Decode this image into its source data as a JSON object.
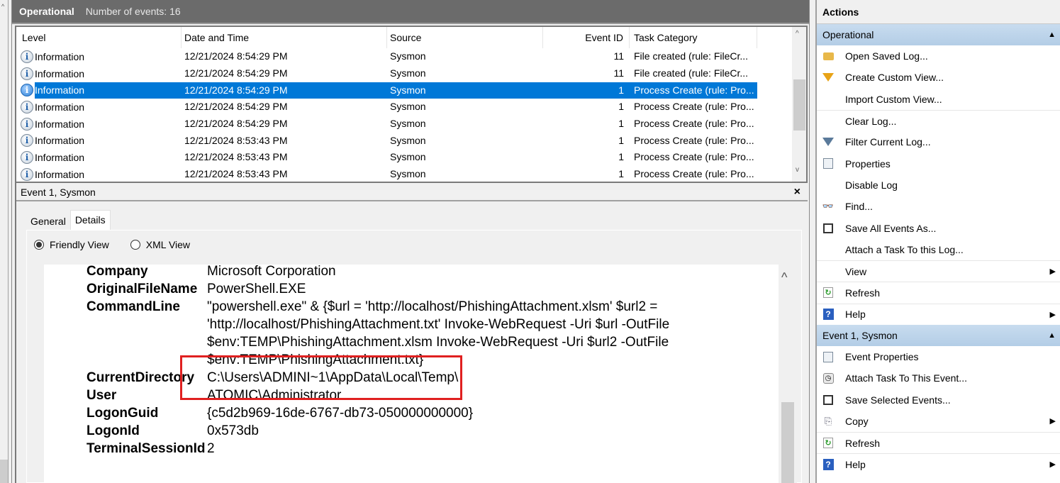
{
  "log": {
    "name": "Operational",
    "event_count": "Number of events: 16"
  },
  "events_table": {
    "columns": [
      "Level",
      "Date and Time",
      "Source",
      "Event ID",
      "Task Category"
    ],
    "rows": [
      {
        "level": "Information",
        "datetime": "12/21/2024 8:54:29 PM",
        "source": "Sysmon",
        "event_id": "11",
        "task": "File created (rule: FileCr...",
        "selected": false
      },
      {
        "level": "Information",
        "datetime": "12/21/2024 8:54:29 PM",
        "source": "Sysmon",
        "event_id": "11",
        "task": "File created (rule: FileCr...",
        "selected": false
      },
      {
        "level": "Information",
        "datetime": "12/21/2024 8:54:29 PM",
        "source": "Sysmon",
        "event_id": "1",
        "task": "Process Create (rule: Pro...",
        "selected": true
      },
      {
        "level": "Information",
        "datetime": "12/21/2024 8:54:29 PM",
        "source": "Sysmon",
        "event_id": "1",
        "task": "Process Create (rule: Pro...",
        "selected": false
      },
      {
        "level": "Information",
        "datetime": "12/21/2024 8:54:29 PM",
        "source": "Sysmon",
        "event_id": "1",
        "task": "Process Create (rule: Pro...",
        "selected": false
      },
      {
        "level": "Information",
        "datetime": "12/21/2024 8:53:43 PM",
        "source": "Sysmon",
        "event_id": "1",
        "task": "Process Create (rule: Pro...",
        "selected": false
      },
      {
        "level": "Information",
        "datetime": "12/21/2024 8:53:43 PM",
        "source": "Sysmon",
        "event_id": "1",
        "task": "Process Create (rule: Pro...",
        "selected": false
      },
      {
        "level": "Information",
        "datetime": "12/21/2024 8:53:43 PM",
        "source": "Sysmon",
        "event_id": "1",
        "task": "Process Create (rule: Pro...",
        "selected": false
      }
    ]
  },
  "detail": {
    "title": "Event 1, Sysmon",
    "close_icon": "×",
    "tabs": [
      {
        "label": "General",
        "active": false
      },
      {
        "label": "Details",
        "active": true
      }
    ],
    "view_options": [
      {
        "label": "Friendly View",
        "checked": true
      },
      {
        "label": "XML View",
        "checked": false
      }
    ],
    "fields": [
      {
        "key": "Company",
        "value": "Microsoft Corporation"
      },
      {
        "key": "OriginalFileName",
        "value": "PowerShell.EXE"
      },
      {
        "key": "CommandLine",
        "value": "\"powershell.exe\" & {$url = 'http://localhost/PhishingAttachment.xlsm' $url2 = 'http://localhost/PhishingAttachment.txt' Invoke-WebRequest -Uri $url -OutFile $env:TEMP\\PhishingAttachment.xlsm Invoke-WebRequest -Uri $url2 -OutFile $env:TEMP\\PhishingAttachment.txt}"
      },
      {
        "key": "CurrentDirectory",
        "value": "C:\\Users\\ADMINI~1\\AppData\\Local\\Temp\\"
      },
      {
        "key": "User",
        "value": "ATOMIC\\Administrator"
      },
      {
        "key": "LogonGuid",
        "value": "{c5d2b969-16de-6767-db73-050000000000}"
      },
      {
        "key": "LogonId",
        "value": "0x573db"
      },
      {
        "key": "TerminalSessionId",
        "value": "2"
      }
    ],
    "highlight_color": "#e02020"
  },
  "actions": {
    "title": "Actions",
    "groups": [
      {
        "label": "Operational",
        "items": [
          {
            "label": "Open Saved Log...",
            "icon": "folder-icon",
            "submenu": false
          },
          {
            "label": "Create Custom View...",
            "icon": "funnel-icon",
            "submenu": false
          },
          {
            "label": "Import Custom View...",
            "icon": "",
            "submenu": false
          },
          {
            "label": "Clear Log...",
            "icon": "",
            "submenu": false
          },
          {
            "label": "Filter Current Log...",
            "icon": "filter-icon",
            "submenu": false
          },
          {
            "label": "Properties",
            "icon": "properties-icon",
            "submenu": false
          },
          {
            "label": "Disable Log",
            "icon": "",
            "submenu": false
          },
          {
            "label": "Find...",
            "icon": "binoculars-icon",
            "submenu": false
          },
          {
            "label": "Save All Events As...",
            "icon": "save-icon",
            "submenu": false
          },
          {
            "label": "Attach a Task To this Log...",
            "icon": "",
            "submenu": false
          },
          {
            "label": "View",
            "icon": "",
            "submenu": true
          },
          {
            "label": "Refresh",
            "icon": "refresh-icon",
            "submenu": false
          },
          {
            "label": "Help",
            "icon": "help-icon",
            "submenu": true
          }
        ]
      },
      {
        "label": "Event 1, Sysmon",
        "items": [
          {
            "label": "Event Properties",
            "icon": "properties-icon",
            "submenu": false
          },
          {
            "label": "Attach Task To This Event...",
            "icon": "task-clock-icon",
            "submenu": false
          },
          {
            "label": "Save Selected Events...",
            "icon": "save-icon",
            "submenu": false
          },
          {
            "label": "Copy",
            "icon": "copy-icon",
            "submenu": true
          },
          {
            "label": "Refresh",
            "icon": "refresh-icon",
            "submenu": false
          },
          {
            "label": "Help",
            "icon": "help-icon",
            "submenu": true
          }
        ]
      }
    ]
  },
  "colors": {
    "selection": "#0078d7",
    "group_header": "#b3cde6",
    "top_bar": "#6b6b6b"
  }
}
